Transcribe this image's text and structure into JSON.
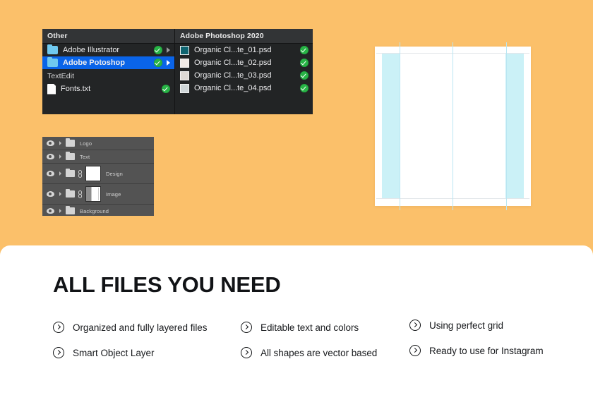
{
  "theme": {
    "background": "#fbc06a",
    "card_background": "#ffffff",
    "panel_dark": "#222425",
    "selection_blue": "#0a64e8",
    "check_green": "#28b446",
    "grid_cyan": "#cbf1f7",
    "text_dark": "#111316"
  },
  "finder": {
    "left_column": {
      "header": "Other",
      "items": [
        {
          "label": "Adobe Illustrator",
          "icon": "folder-icon",
          "badge": "check-badge",
          "disclosure": "triangle-right-icon",
          "selected": false
        },
        {
          "label": "Adobe Potoshop",
          "icon": "folder-icon",
          "badge": "check-badge",
          "disclosure": "triangle-right-icon",
          "selected": true
        }
      ],
      "subheader": "TextEdit",
      "sub_items": [
        {
          "label": "Fonts.txt",
          "icon": "document-icon",
          "badge": "check-badge"
        }
      ]
    },
    "right_column": {
      "header": "Adobe Photoshop 2020",
      "items": [
        {
          "label": "Organic Cl...te_01.psd",
          "icon": "psd-thumbnail-icon",
          "badge": "check-badge"
        },
        {
          "label": "Organic Cl...te_02.psd",
          "icon": "psd-thumbnail-icon",
          "badge": "check-badge"
        },
        {
          "label": "Organic Cl...te_03.psd",
          "icon": "psd-thumbnail-icon",
          "badge": "check-badge"
        },
        {
          "label": "Organic Cl...te_04.psd",
          "icon": "psd-thumbnail-icon",
          "badge": "check-badge"
        }
      ]
    }
  },
  "layers_panel": {
    "rows": [
      {
        "name": "Logo",
        "visible": true,
        "has_thumbnail": false,
        "has_link": false
      },
      {
        "name": "Text",
        "visible": true,
        "has_thumbnail": false,
        "has_link": false
      },
      {
        "name": "Design",
        "visible": true,
        "has_thumbnail": true,
        "has_link": true
      },
      {
        "name": "Image",
        "visible": true,
        "has_thumbnail": true,
        "has_link": true
      },
      {
        "name": "Background",
        "visible": true,
        "has_thumbnail": false,
        "has_link": false
      }
    ]
  },
  "canvas_preview": {
    "label": "grid-guides-preview",
    "columns": 3,
    "margin_color": "#cbf1f7",
    "guide_color": "#b9e6f2"
  },
  "card": {
    "title": "ALL FILES YOU NEED",
    "columns": [
      {
        "items": [
          {
            "label": "Organized and fully layered files",
            "icon": "arrow-circle-right-icon"
          },
          {
            "label": "Smart Object Layer",
            "icon": "arrow-circle-right-icon"
          }
        ]
      },
      {
        "items": [
          {
            "label": "Editable text and colors",
            "icon": "arrow-circle-right-icon"
          },
          {
            "label": "All shapes are vector based",
            "icon": "arrow-circle-right-icon"
          }
        ]
      },
      {
        "items": [
          {
            "label": "Using perfect grid",
            "icon": "arrow-circle-right-icon"
          },
          {
            "label": "Ready to use for Instagram",
            "icon": "arrow-circle-right-icon"
          }
        ]
      }
    ]
  }
}
